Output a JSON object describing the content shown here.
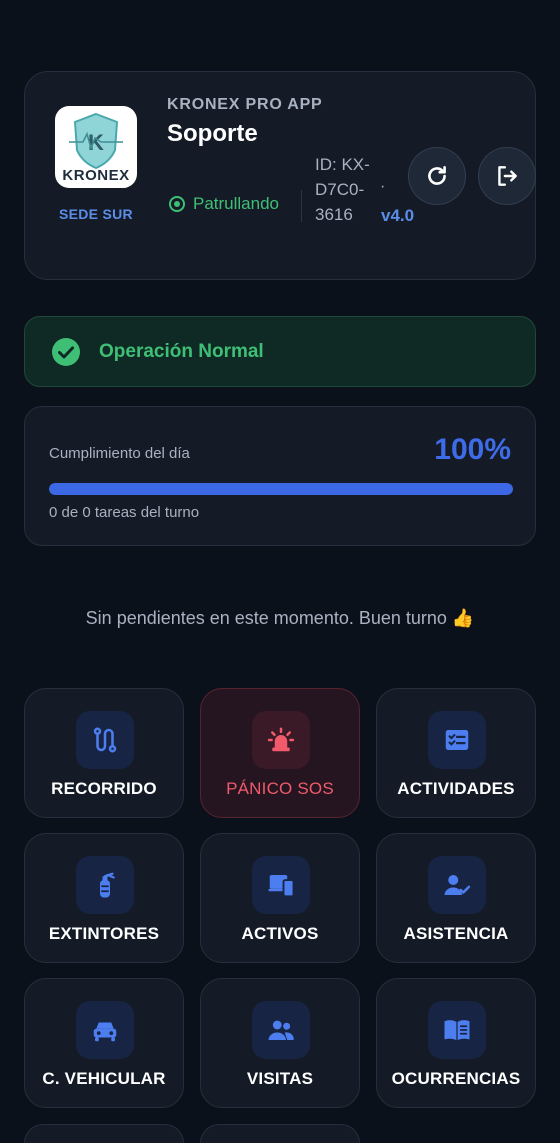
{
  "header": {
    "app_name": "KRONEX PRO APP",
    "title": "Soporte",
    "logo_text": "KRONEX",
    "site": "SEDE SUR",
    "status": "Patrullando",
    "device_id": "ID: KX-D7C0-3616",
    "separator": "·",
    "version": "v4.0"
  },
  "banner": {
    "text": "Operación Normal"
  },
  "progress": {
    "label": "Cumplimiento del día",
    "value_text": "100%",
    "value": 1.0,
    "subtitle": "0 de 0 tareas del turno"
  },
  "empty_message": "Sin pendientes en este momento. Buen turno 👍",
  "tiles": [
    {
      "label": "RECORRIDO",
      "icon": "route-icon"
    },
    {
      "label": "PÁNICO SOS",
      "icon": "siren-icon"
    },
    {
      "label": "ACTIVIDADES",
      "icon": "checklist-icon"
    },
    {
      "label": "EXTINTORES",
      "icon": "fire-extinguisher-icon"
    },
    {
      "label": "ACTIVOS",
      "icon": "devices-icon"
    },
    {
      "label": "ASISTENCIA",
      "icon": "user-check-icon"
    },
    {
      "label": "C. VEHICULAR",
      "icon": "car-icon"
    },
    {
      "label": "VISITAS",
      "icon": "users-icon"
    },
    {
      "label": "OCURRENCIAS",
      "icon": "book-icon"
    }
  ],
  "colors": {
    "accent": "#3d68e5",
    "success": "#3fbf76",
    "danger": "#f05a6a",
    "background": "#0b111b"
  }
}
